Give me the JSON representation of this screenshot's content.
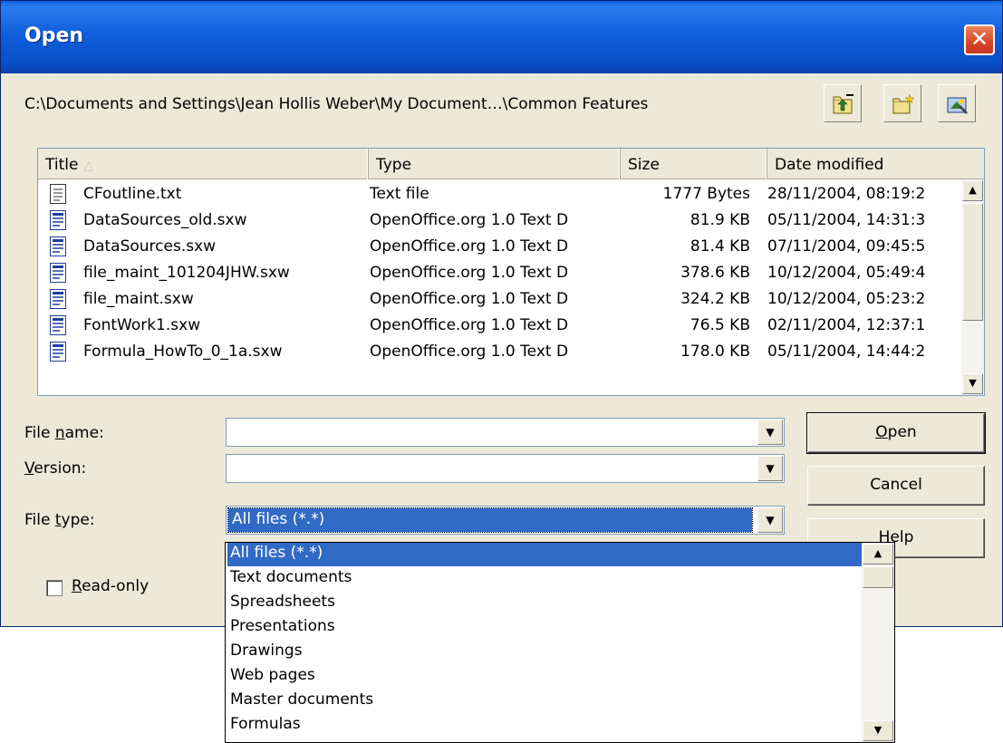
{
  "window": {
    "title": "Open",
    "close_glyph": "✕"
  },
  "path": "C:\\Documents and Settings\\Jean Hollis Weber\\My Document…\\Common Features",
  "toolbar": {
    "icons": [
      "up-folder-icon",
      "new-folder-icon",
      "default-directory-icon"
    ]
  },
  "file_list": {
    "columns": [
      "Title",
      "Type",
      "Size",
      "Date modified"
    ],
    "sort_indicator": "△",
    "rows": [
      {
        "icon": "text-file-icon",
        "title": "CFoutline.txt",
        "type": "Text file",
        "size": "1777 Bytes",
        "date": "28/11/2004, 08:19:2"
      },
      {
        "icon": "writer-doc-icon",
        "title": "DataSources_old.sxw",
        "type": "OpenOffice.org  1.0 Text D",
        "size": "81.9 KB",
        "date": "05/11/2004, 14:31:3"
      },
      {
        "icon": "writer-doc-icon",
        "title": "DataSources.sxw",
        "type": "OpenOffice.org  1.0 Text D",
        "size": "81.4 KB",
        "date": "07/11/2004, 09:45:5"
      },
      {
        "icon": "writer-doc-icon",
        "title": "file_maint_101204JHW.sxw",
        "type": "OpenOffice.org  1.0 Text D",
        "size": "378.6 KB",
        "date": "10/12/2004, 05:49:4"
      },
      {
        "icon": "writer-doc-icon",
        "title": "file_maint.sxw",
        "type": "OpenOffice.org  1.0 Text D",
        "size": "324.2 KB",
        "date": "10/12/2004, 05:23:2"
      },
      {
        "icon": "writer-doc-icon",
        "title": "FontWork1.sxw",
        "type": "OpenOffice.org  1.0 Text D",
        "size": "76.5 KB",
        "date": "02/11/2004, 12:37:1"
      },
      {
        "icon": "writer-doc-icon",
        "title": "Formula_HowTo_0_1a.sxw",
        "type": "OpenOffice.org  1.0 Text D",
        "size": "178.0 KB",
        "date": "05/11/2004, 14:44:2"
      }
    ]
  },
  "form": {
    "file_name": {
      "label_pre": "File ",
      "label_key": "n",
      "label_post": "ame:",
      "value": ""
    },
    "version": {
      "label_pre": "",
      "label_key": "V",
      "label_post": "ersion:",
      "value": ""
    },
    "file_type": {
      "label_pre": "File ",
      "label_key": "t",
      "label_post": "ype:",
      "value": "All files (*.*)"
    },
    "read_only": {
      "label_pre": "",
      "label_key": "R",
      "label_post": "ead-only",
      "checked": false
    }
  },
  "buttons": {
    "open": {
      "pre": "",
      "key": "O",
      "post": "pen"
    },
    "cancel": "Cancel",
    "help": "Help"
  },
  "file_type_options": [
    "All files (*.*)",
    "Text documents",
    "Spreadsheets",
    "Presentations",
    "Drawings",
    "Web pages",
    "Master documents",
    "Formulas"
  ],
  "selected_option_index": 0,
  "colors": {
    "titlebar": "#0a5fd8",
    "selection": "#316ac5",
    "dialog_bg": "#ece9d8"
  }
}
